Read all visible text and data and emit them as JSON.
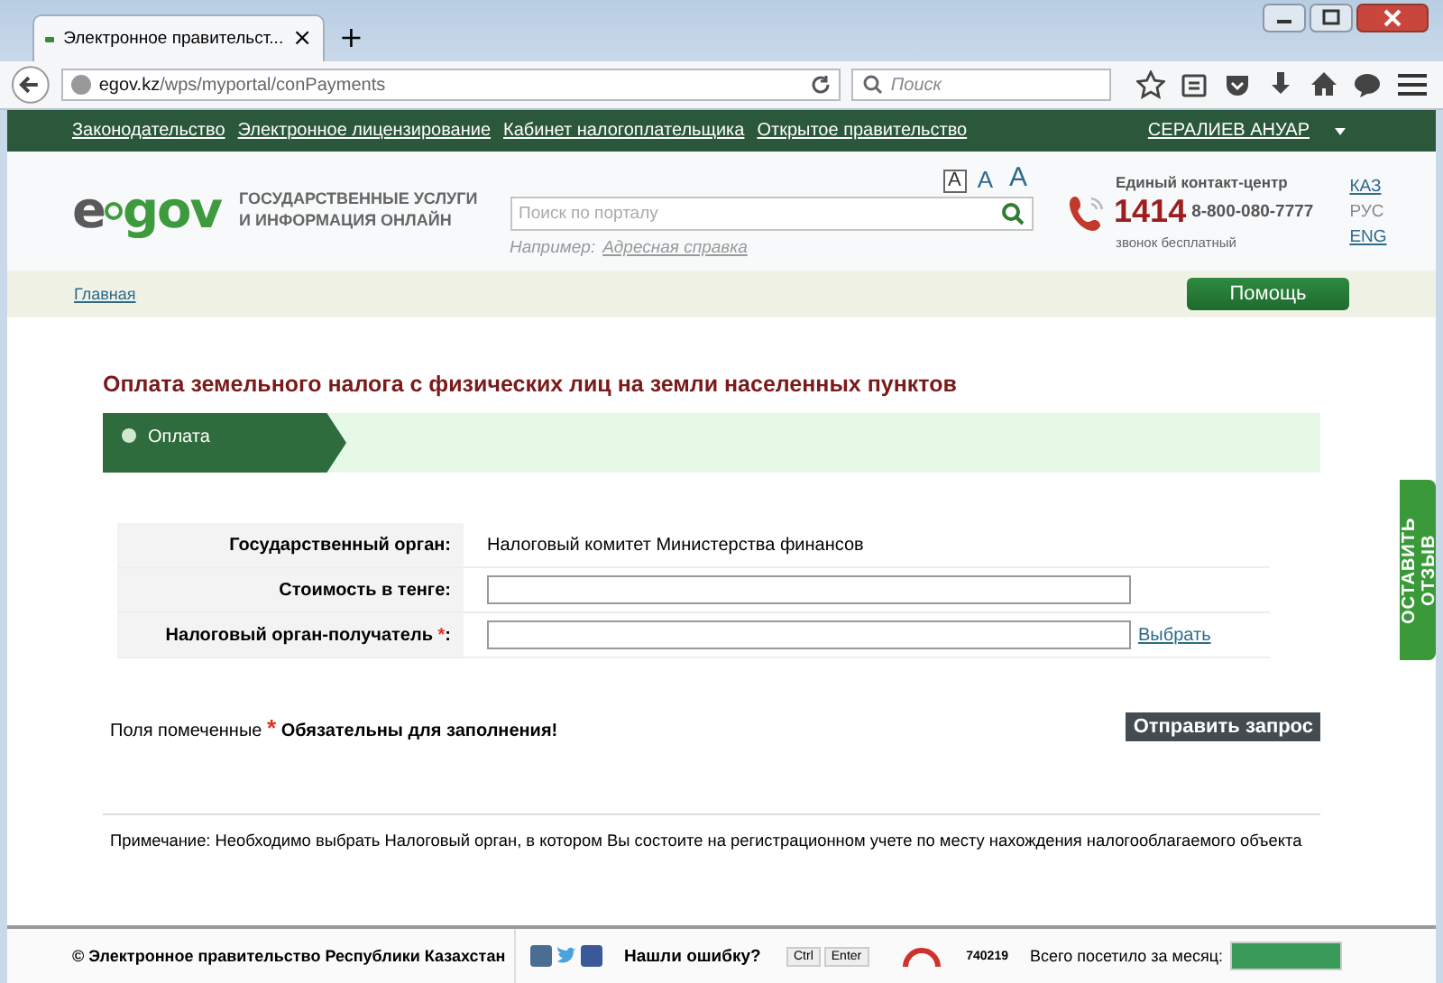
{
  "browser": {
    "tab_title": "Электронное правительст...",
    "tab_close": "×",
    "new_tab": "+",
    "url": "**egov.kz**/wps/myportal/conPayments",
    "search_placeholder": "Поиск"
  },
  "top_nav": {
    "links": [
      "Законодательство",
      "Электронное лицензирование",
      "Кабинет налогоплательщика",
      "Открытое правительство"
    ],
    "user": "СЕРАЛИЕВ АНУАР"
  },
  "header": {
    "logo_left": "e",
    "logo_right": "gov",
    "tagline": "ГОСУДАРСТВЕННЫЕ УСЛУГИ И ИНФОРМАЦИЯ ОНЛАЙН",
    "font_sizes": [
      {
        "label": "A",
        "selected": true
      },
      {
        "label": "A",
        "selected": false
      },
      {
        "label": "A",
        "selected": false
      }
    ],
    "search_placeholder": "Поиск по порталу",
    "example_label": "Например:",
    "example_link": "Адресная справка",
    "contact_title": "Единый контакт-центр",
    "short_number": "1414",
    "phone": "8-800-080-7777",
    "call_note": "звонок бесплатный",
    "languages": [
      {
        "label": "КАЗ",
        "selected": false
      },
      {
        "label": "РУС",
        "selected": true
      },
      {
        "label": "ENG",
        "selected": false
      }
    ]
  },
  "breadcrumb": "Главная",
  "help_button": "Помощь",
  "page_title": "Оплата земельного налога с физических лиц на земли населенных пунктов",
  "steps": [
    {
      "label": "Оплата",
      "selected": true
    }
  ],
  "form": [
    {
      "kind": "text",
      "label": "Государственный орган:",
      "required": false,
      "value": "Налоговый комитет Министерства финансов"
    },
    {
      "kind": "input",
      "label": "Стоимость в тенге:",
      "required": false
    },
    {
      "kind": "input",
      "label": "Налоговый орган-получатель",
      "required": true,
      "suffix": ":",
      "link": "Выбрать"
    }
  ],
  "required_note": {
    "prefix": "Поля помеченные",
    "star": "*",
    "suffix": "Обязательны для заполнения!"
  },
  "submit_button": "Отправить запрос",
  "note": "Примечание: Необходимо выбрать Налоговый орган, в котором Вы состоите на регистрационном учете по месту нахождения налогооблагаемого объекта",
  "feedback_tab": "ОСТАВИТЬ ОТЗЫВ",
  "footer": {
    "copyright": "© Электронное правительство Республики Казахстан",
    "error_prompt": "Нашли ошибку?",
    "keys": [
      "Ctrl",
      "Enter"
    ],
    "counter": "740219",
    "visits_label": "Всего посетило за месяц:"
  }
}
